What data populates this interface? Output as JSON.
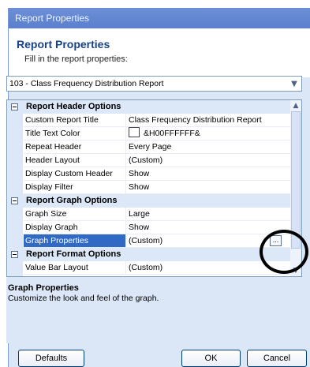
{
  "window": {
    "title": "Report Properties"
  },
  "header": {
    "title": "Report Properties",
    "subtitle": "Fill in the report properties:"
  },
  "report_select": {
    "value": "103 - Class Frequency Distribution Report"
  },
  "grid": {
    "categories": [
      {
        "label": "Report Header Options",
        "rows": [
          {
            "name": "Custom Report Title",
            "value": "Class Frequency Distribution Report"
          },
          {
            "name": "Title Text Color",
            "value": "&H00FFFFFF&"
          },
          {
            "name": "Repeat Header",
            "value": "Every Page"
          },
          {
            "name": "Header Layout",
            "value": "(Custom)"
          },
          {
            "name": "Display Custom Header",
            "value": "Show"
          },
          {
            "name": "Display Filter",
            "value": "Show"
          }
        ]
      },
      {
        "label": "Report Graph Options",
        "rows": [
          {
            "name": "Graph Size",
            "value": "Large"
          },
          {
            "name": "Display Graph",
            "value": "Show"
          },
          {
            "name": "Graph Properties",
            "value": "(Custom)"
          }
        ]
      },
      {
        "label": "Report Format Options",
        "rows": [
          {
            "name": "Value Bar Layout",
            "value": "(Custom)"
          }
        ]
      }
    ],
    "ellipsis": "..."
  },
  "description": {
    "title": "Graph Properties",
    "text": "Customize the look and feel of the graph."
  },
  "buttons": {
    "defaults": "Defaults",
    "ok": "OK",
    "cancel": "Cancel"
  },
  "colors": {
    "selection": "#316ac5",
    "title_text": "#15428b",
    "panel": "#dbe6f7"
  }
}
